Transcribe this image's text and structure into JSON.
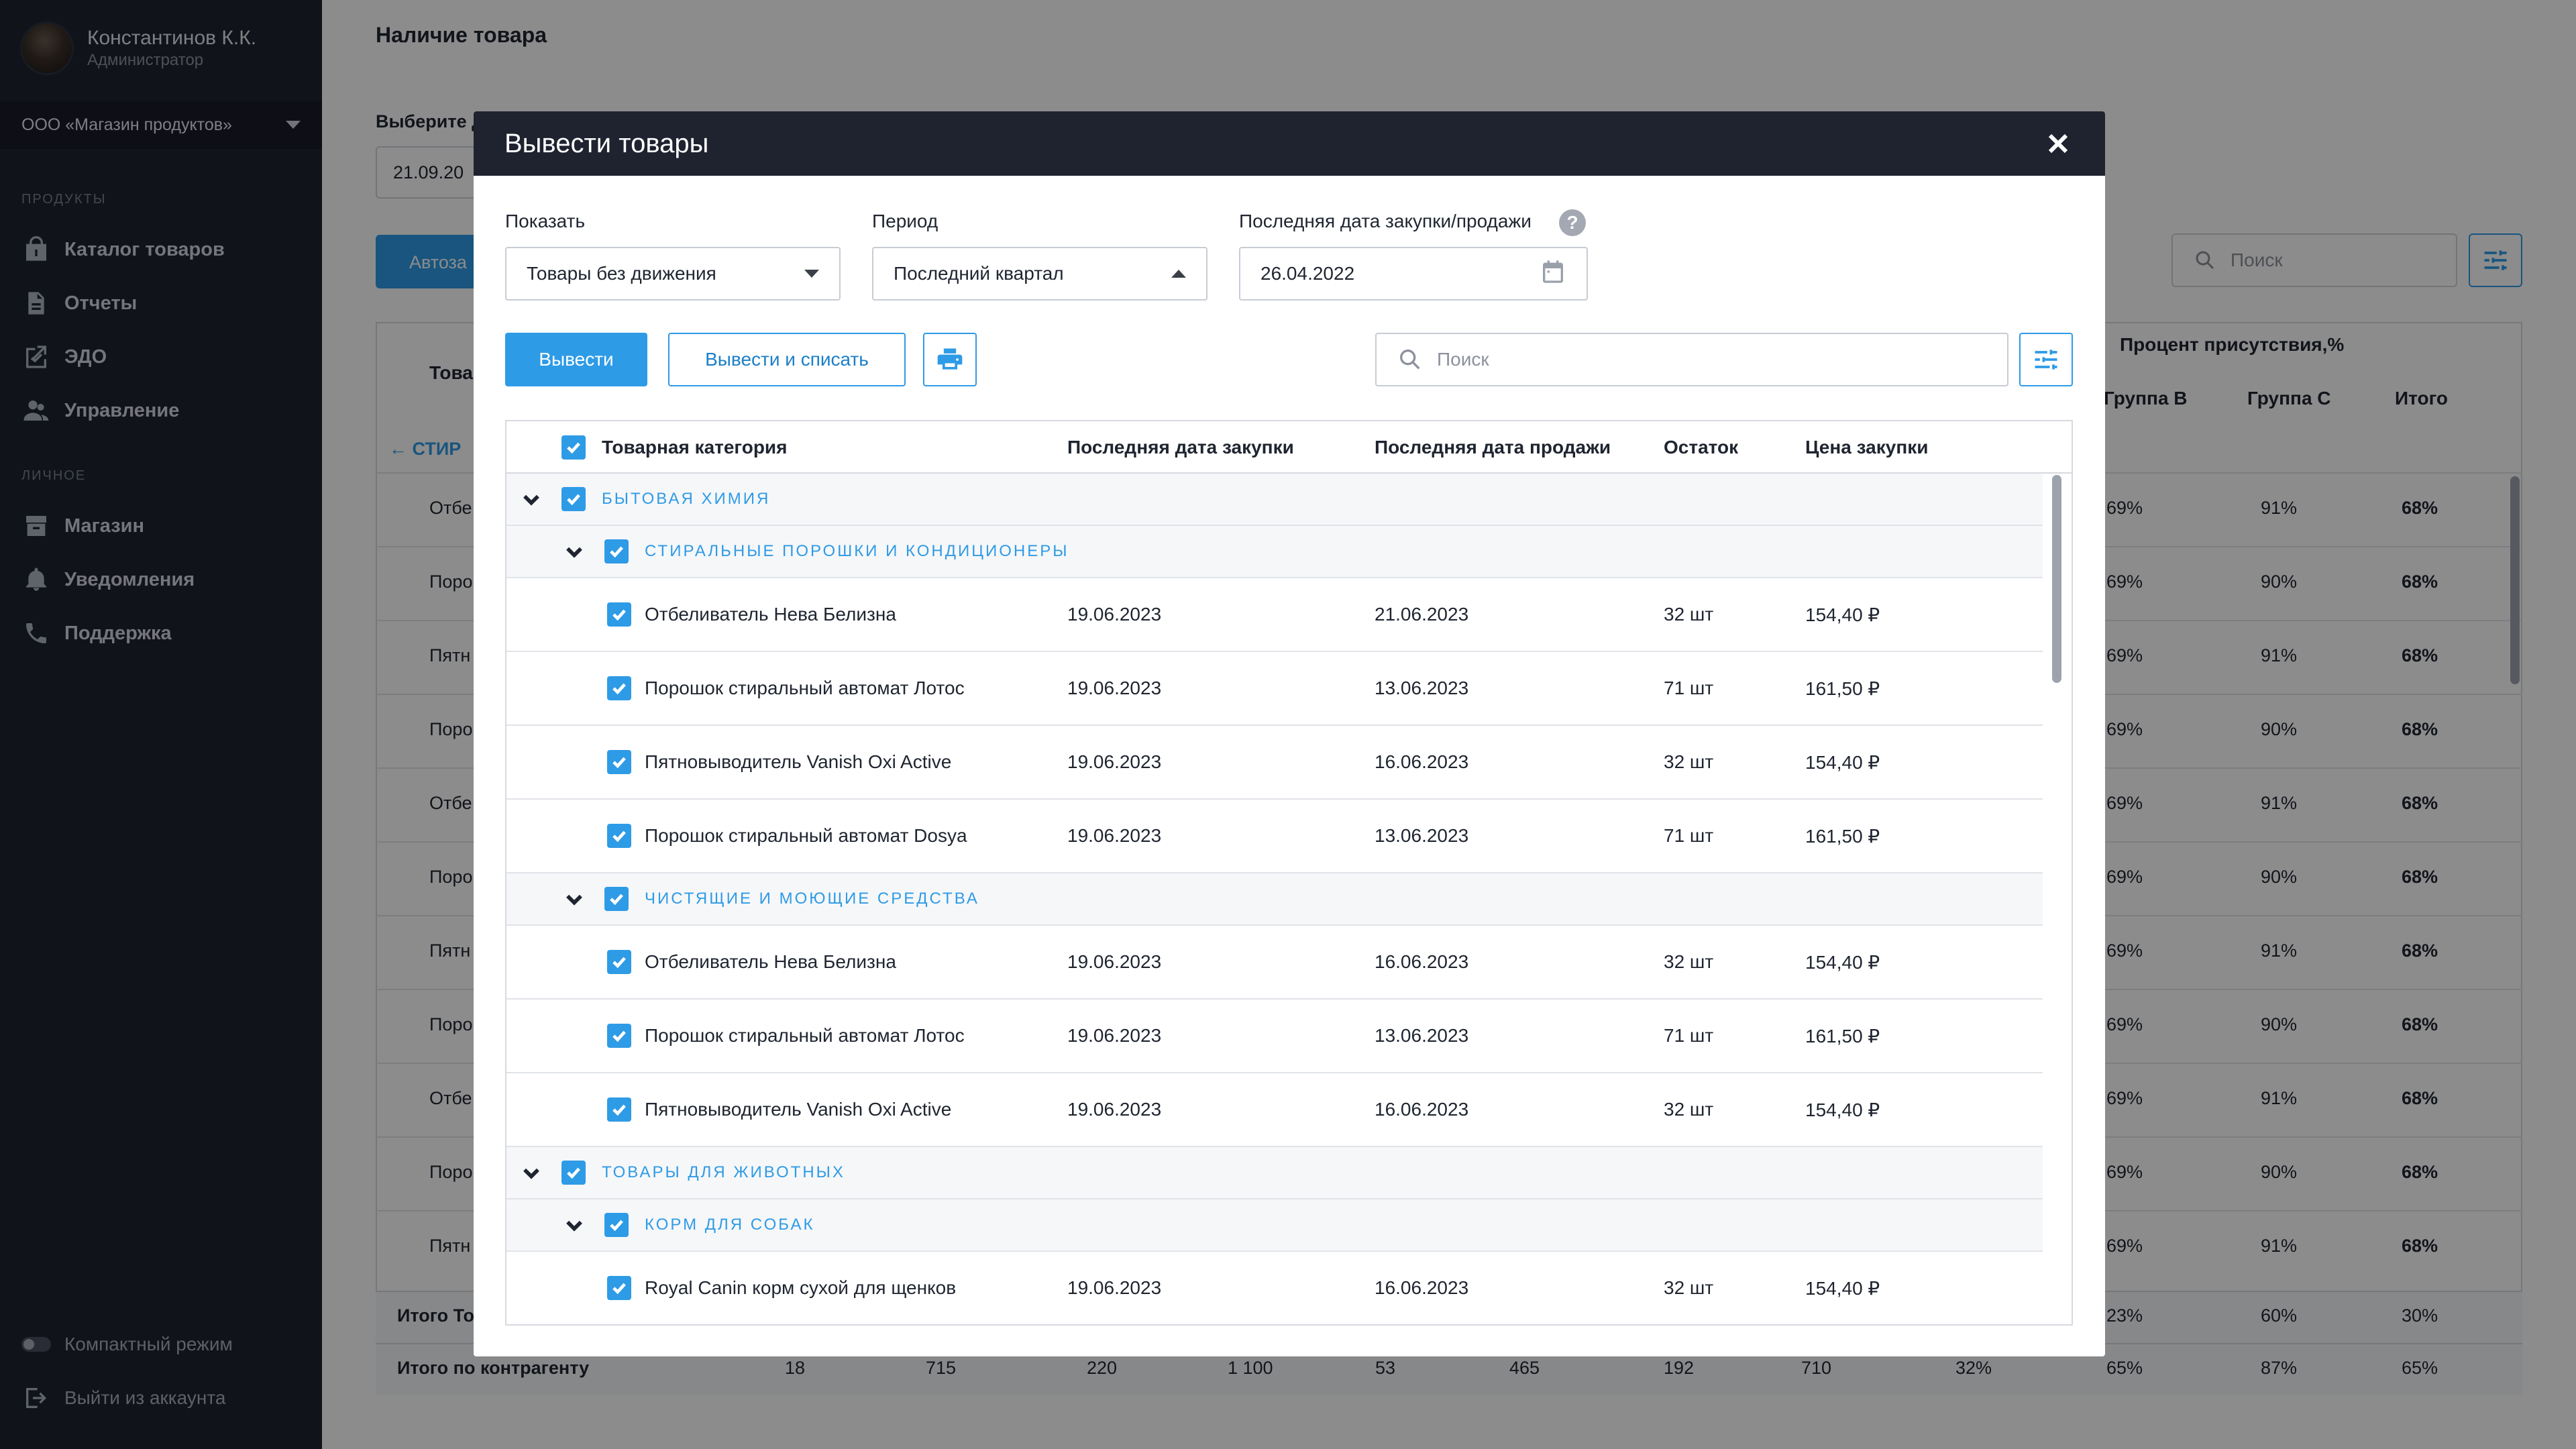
{
  "sidebar": {
    "user_name": "Константинов К.К.",
    "user_role": "Администратор",
    "org": "ООО «Магазин продуктов»",
    "section_products": "ПРОДУКТЫ",
    "section_personal": "ЛИЧНОЕ",
    "items": [
      {
        "label": "Каталог товаров",
        "icon": "bag-icon"
      },
      {
        "label": "Отчеты",
        "icon": "document-icon"
      },
      {
        "label": "ЭДО",
        "icon": "edo-icon"
      },
      {
        "label": "Управление",
        "icon": "users-icon"
      },
      {
        "label": "Магазин",
        "icon": "store-icon"
      },
      {
        "label": "Уведомления",
        "icon": "bell-icon"
      },
      {
        "label": "Поддержка",
        "icon": "phone-icon"
      }
    ],
    "compact_mode": "Компактный режим",
    "logout": "Выйти из аккаунта"
  },
  "background": {
    "title": "Наличие товара",
    "choose_label": "Выберите д",
    "date_value": "21.09.20",
    "auto_button": "Автоза",
    "search_placeholder": "Поиск",
    "header_col1": "Това",
    "header_span": "Процент присутствия,%",
    "header_group_b": "Группа B",
    "header_group_c": "Группа C",
    "header_total": "Итого",
    "back_label": "СТИР",
    "rows": [
      {
        "name": "Отбе",
        "b": "69%",
        "c": "91%",
        "t": "68%"
      },
      {
        "name": "Поро",
        "b": "69%",
        "c": "90%",
        "t": "68%"
      },
      {
        "name": "Пятн",
        "b": "69%",
        "c": "91%",
        "t": "68%"
      },
      {
        "name": "Поро",
        "b": "69%",
        "c": "90%",
        "t": "68%"
      },
      {
        "name": "Отбе",
        "b": "69%",
        "c": "91%",
        "t": "68%"
      },
      {
        "name": "Поро",
        "b": "69%",
        "c": "90%",
        "t": "68%"
      },
      {
        "name": "Пятн",
        "b": "69%",
        "c": "91%",
        "t": "68%"
      },
      {
        "name": "Поро",
        "b": "69%",
        "c": "90%",
        "t": "68%"
      },
      {
        "name": "Отбе",
        "b": "69%",
        "c": "91%",
        "t": "68%"
      },
      {
        "name": "Поро",
        "b": "69%",
        "c": "90%",
        "t": "68%"
      },
      {
        "name": "Пятн",
        "b": "69%",
        "c": "91%",
        "t": "68%"
      }
    ],
    "total1": {
      "label": "Итого То",
      "b": "23%",
      "c": "60%",
      "t": "30%"
    },
    "total2": {
      "label": "Итого по контрагенту",
      "values": [
        "18",
        "715",
        "220",
        "1 100",
        "53",
        "465",
        "192",
        "710",
        "32%",
        "65%",
        "87%",
        "65%"
      ]
    }
  },
  "modal": {
    "title": "Вывести товары",
    "show_label": "Показать",
    "show_value": "Товары без движения",
    "period_label": "Период",
    "period_value": "Последний квартал",
    "last_date_label": "Последняя дата закупки/продажи",
    "last_date_value": "26.04.2022",
    "help_glyph": "?",
    "btn_withdraw": "Вывести",
    "btn_withdraw_writeoff": "Вывести и списать",
    "search_placeholder": "Поиск",
    "columns": {
      "category": "Товарная категория",
      "last_purchase": "Последняя дата закупки",
      "last_sale": "Последняя дата продажи",
      "stock": "Остаток",
      "price": "Цена закупки"
    },
    "rows": [
      {
        "type": "cat",
        "label": "БЫТОВАЯ ХИМИЯ"
      },
      {
        "type": "sub",
        "label": "СТИРАЛЬНЫЕ ПОРОШКИ И КОНДИЦИОНЕРЫ"
      },
      {
        "type": "item",
        "name": "Отбеливатель Нева Белизна",
        "purchase": "19.06.2023",
        "sale": "21.06.2023",
        "stock": "32 шт",
        "price": "154,40 ₽"
      },
      {
        "type": "item",
        "name": "Порошок стиральный автомат Лотос",
        "purchase": "19.06.2023",
        "sale": "13.06.2023",
        "stock": "71 шт",
        "price": "161,50 ₽"
      },
      {
        "type": "item",
        "name": "Пятновыводитель Vanish Oxi Active",
        "purchase": "19.06.2023",
        "sale": "16.06.2023",
        "stock": "32 шт",
        "price": "154,40 ₽"
      },
      {
        "type": "item",
        "name": "Порошок стиральный автомат Dosya",
        "purchase": "19.06.2023",
        "sale": "13.06.2023",
        "stock": "71 шт",
        "price": "161,50 ₽"
      },
      {
        "type": "sub",
        "label": "ЧИСТЯЩИЕ И МОЮЩИЕ СРЕДСТВА"
      },
      {
        "type": "item",
        "name": "Отбеливатель Нева Белизна",
        "purchase": "19.06.2023",
        "sale": "16.06.2023",
        "stock": "32 шт",
        "price": "154,40 ₽"
      },
      {
        "type": "item",
        "name": "Порошок стиральный автомат Лотос",
        "purchase": "19.06.2023",
        "sale": "13.06.2023",
        "stock": "71 шт",
        "price": "161,50 ₽"
      },
      {
        "type": "item",
        "name": "Пятновыводитель Vanish Oxi Active",
        "purchase": "19.06.2023",
        "sale": "16.06.2023",
        "stock": "32 шт",
        "price": "154,40 ₽"
      },
      {
        "type": "cat",
        "label": "ТОВАРЫ ДЛЯ ЖИВОТНЫХ"
      },
      {
        "type": "sub",
        "label": "КОРМ ДЛЯ СОБАК"
      },
      {
        "type": "item",
        "name": "Royal Canin корм сухой для щенков",
        "purchase": "19.06.2023",
        "sale": "16.06.2023",
        "stock": "32 шт",
        "price": "154,40 ₽"
      }
    ]
  },
  "colors": {
    "accent": "#2e9be6",
    "sidebar": "#1f2330",
    "overlay": "rgba(0,0,0,0.45)"
  }
}
